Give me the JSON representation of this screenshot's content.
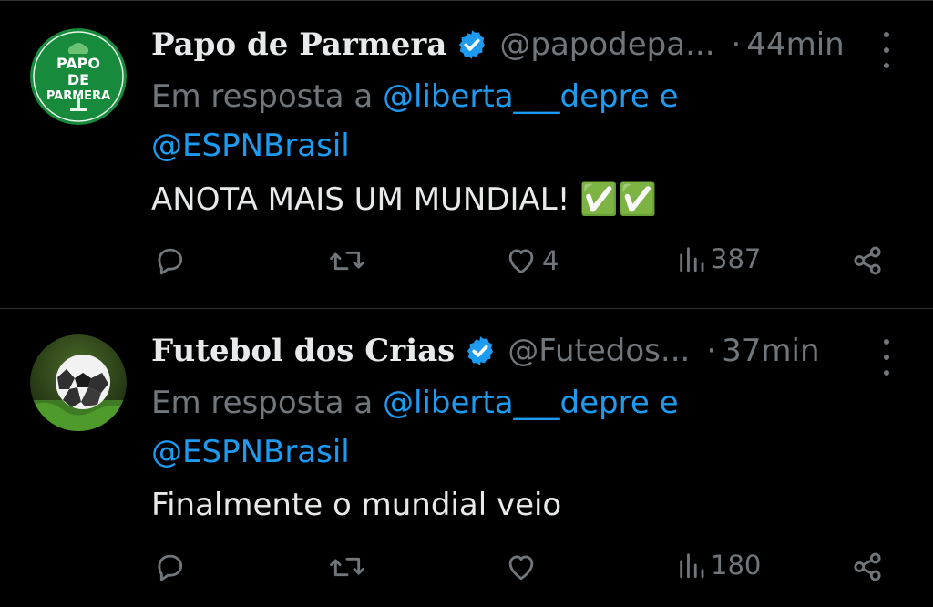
{
  "tweets": [
    {
      "avatar": {
        "line1": "PAPO",
        "line2": "DE",
        "line3": "PARMERA"
      },
      "display_name": "Papo de Parmera",
      "handle": "@papodepa...",
      "separator": "·",
      "time": "44min",
      "reply_prefix": "Em resposta a",
      "mention_1": "@liberta___depre",
      "reply_and": "e",
      "mention_2": "@ESPNBrasil",
      "text": "ANOTA MAIS UM MUNDIAL! ✅✅",
      "replies": "",
      "retweets": "",
      "likes": "4",
      "views": "387"
    },
    {
      "display_name": "Futebol dos Crias",
      "handle": "@Futedos...",
      "separator": "·",
      "time": "37min",
      "reply_prefix": "Em resposta a",
      "mention_1": "@liberta___depre",
      "reply_and": "e",
      "mention_2": "@ESPNBrasil",
      "text": "Finalmente o mundial veio",
      "replies": "",
      "retweets": "",
      "likes": "",
      "views": "180"
    }
  ],
  "colors": {
    "background": "#000000",
    "primary_text": "#e7e9ea",
    "secondary_text": "#71767b",
    "link": "#1d9bf0",
    "verified": "#1d9bf0",
    "check_emoji": "#78b159",
    "avatar_green": "#178a3c"
  },
  "icons": [
    "verified-badge-icon",
    "more-icon",
    "reply-icon",
    "retweet-icon",
    "like-icon",
    "views-icon",
    "share-icon",
    "check-mark-emoji"
  ]
}
